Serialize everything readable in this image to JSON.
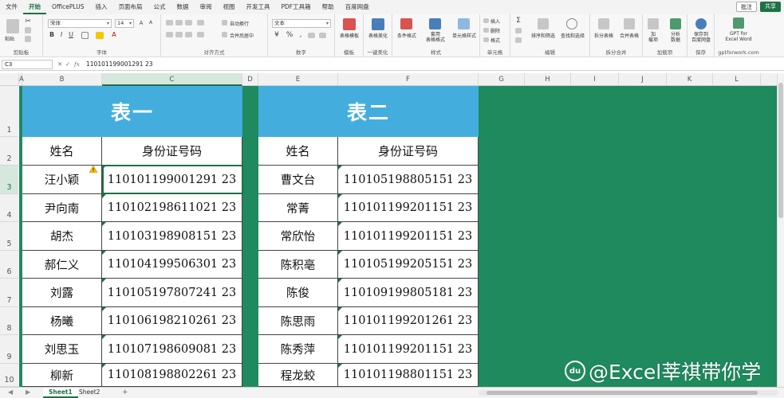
{
  "menu": {
    "items": [
      "文件",
      "开始",
      "OfficePLUS",
      "插入",
      "页面布局",
      "公式",
      "数据",
      "审阅",
      "视图",
      "开发工具",
      "PDF工具箱",
      "帮助",
      "百度网盘"
    ],
    "active_index": 1,
    "comment_label": "批注",
    "share_label": "共享"
  },
  "ribbon": {
    "groups": {
      "clipboard": "剪贴板",
      "font": "字体",
      "align": "对齐方式",
      "number": "数字",
      "template": "模板",
      "beautify": "一键美化",
      "style": "样式",
      "cells": "单元格",
      "edit": "编辑",
      "split": "拆分合并",
      "addin": "加载项",
      "save": "保存"
    },
    "paste_label": "粘贴",
    "font_name": "宋体",
    "font_size": "14",
    "wrap_label": "自动换行",
    "merge_label": "合并后居中",
    "number_format": "文本",
    "table_template": "表格模板",
    "table_beautify": "表格美化",
    "cond_format": "条件格式",
    "apply_table": "套用\n表格格式",
    "cell_style": "单元格样式",
    "insert": "插入",
    "delete": "删除",
    "format": "格式",
    "sort_filter": "排序和筛选",
    "find_select": "查找和选择",
    "split_table": "拆分表格",
    "merge_table": "合并表格",
    "addin_btn": "加\n载项",
    "analyze_btn": "分析\n数据",
    "save_baidu": "保存到\n百度网盘",
    "gpt_label": "GPT for\nExcel Word",
    "gpt_url": "gptforwork.com"
  },
  "formula_bar": {
    "name_box": "C3",
    "value": "110101199001291 23"
  },
  "columns": [
    "A",
    "B",
    "C",
    "D",
    "E",
    "F",
    "G",
    "H",
    "I",
    "J",
    "K",
    "L"
  ],
  "rows": [
    "1",
    "2",
    "3",
    "4",
    "5",
    "6",
    "7",
    "8",
    "9",
    "10"
  ],
  "table1": {
    "title": "表一",
    "header_name": "姓名",
    "header_id": "身份证号码",
    "names": [
      "汪小颖",
      "尹向南",
      "胡杰",
      "郝仁义",
      "刘露",
      "杨曦",
      "刘思玉",
      "柳新"
    ],
    "ids": [
      "110101199001291 23",
      "110102198611021 23",
      "110103198908151 23",
      "110104199506301 23",
      "110105197807241 23",
      "110106198210261 23",
      "110107198609081 23",
      "110108198802261 23"
    ]
  },
  "table2": {
    "title": "表二",
    "header_name": "姓名",
    "header_id": "身份证号码",
    "names": [
      "曹文台",
      "常菁",
      "常欣怡",
      "陈积亳",
      "陈俊",
      "陈思雨",
      "陈秀萍",
      "程龙蛟"
    ],
    "ids": [
      "110105198805151 23",
      "110101199201151 23",
      "110101199201151 23",
      "110105199205151 23",
      "110109199805181 23",
      "110101199201261 23",
      "110101199201151 23",
      "110101198801151 23"
    ]
  },
  "sheets": [
    "Sheet1",
    "Sheet2"
  ],
  "active_sheet": 0,
  "add_sheet": "+",
  "watermark": {
    "logo": "du",
    "text": "@Excel莘祺带你学"
  }
}
